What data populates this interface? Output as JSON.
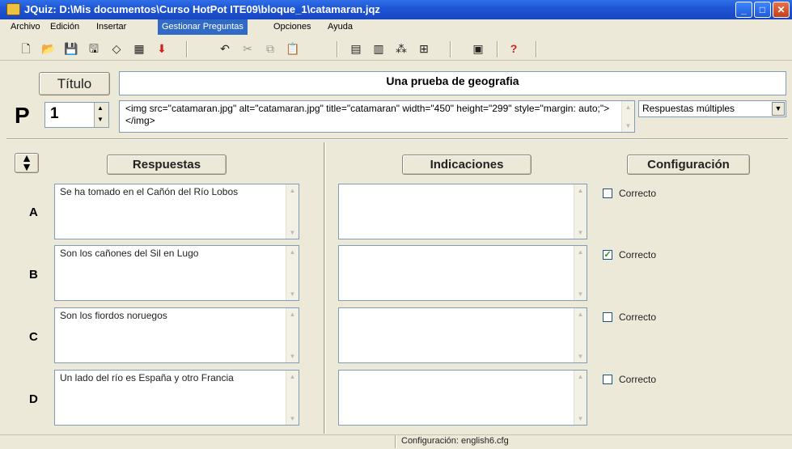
{
  "window": {
    "title": "JQuiz: D:\\Mis documentos\\Curso HotPot ITE09\\bloque_1\\catamaran.jqz"
  },
  "menu": {
    "items": [
      "Archivo",
      "Edición",
      "Insertar",
      "Gestionar Preguntas",
      "Opciones",
      "Ayuda"
    ],
    "active": "Gestionar Preguntas"
  },
  "toolbar": {
    "icons": [
      "new-file-icon",
      "open-folder-icon",
      "save-icon",
      "save-as-icon",
      "eraser-icon",
      "web-export-icon",
      "insert-arrow-icon",
      "undo-icon",
      "cut-icon",
      "copy-icon",
      "paste-icon",
      "add-question-icon",
      "delete-question-icon",
      "link-icon",
      "image-icon",
      "config-icon",
      "help-icon"
    ],
    "help_glyph": "?"
  },
  "header": {
    "title_button": "Título",
    "title_value": "Una prueba de geografia"
  },
  "question": {
    "label": "P",
    "number": "1",
    "text": "<img src=\"catamaran.jpg\" alt=\"catamaran.jpg\" title=\"catamaran\" width=\"450\" height=\"299\" style=\"margin: auto;\"></img>",
    "type": "Respuestas múltiples"
  },
  "columns": {
    "responses": "Respuestas",
    "feedback": "Indicaciones",
    "settings": "Configuración"
  },
  "answers": [
    {
      "letter": "A",
      "text": "Se ha tomado en el Cañón del Río Lobos",
      "feedback": "",
      "correct_label": "Correcto",
      "checked": false
    },
    {
      "letter": "B",
      "text": "Son los cañones del Sil en Lugo",
      "feedback": "",
      "correct_label": "Correcto",
      "checked": true
    },
    {
      "letter": "C",
      "text": "Son los fiordos noruegos",
      "feedback": "",
      "correct_label": "Correcto",
      "checked": false
    },
    {
      "letter": "D",
      "text": "Un lado del río es España y otro Francia",
      "feedback": "",
      "correct_label": "Correcto",
      "checked": false
    }
  ],
  "status": {
    "config": "Configuración: english6.cfg"
  },
  "colors": {
    "titlebar": "#1f56d6",
    "menu_active": "#316ac5",
    "checkbox_check": "#21a121",
    "panel": "#ece9d8"
  }
}
